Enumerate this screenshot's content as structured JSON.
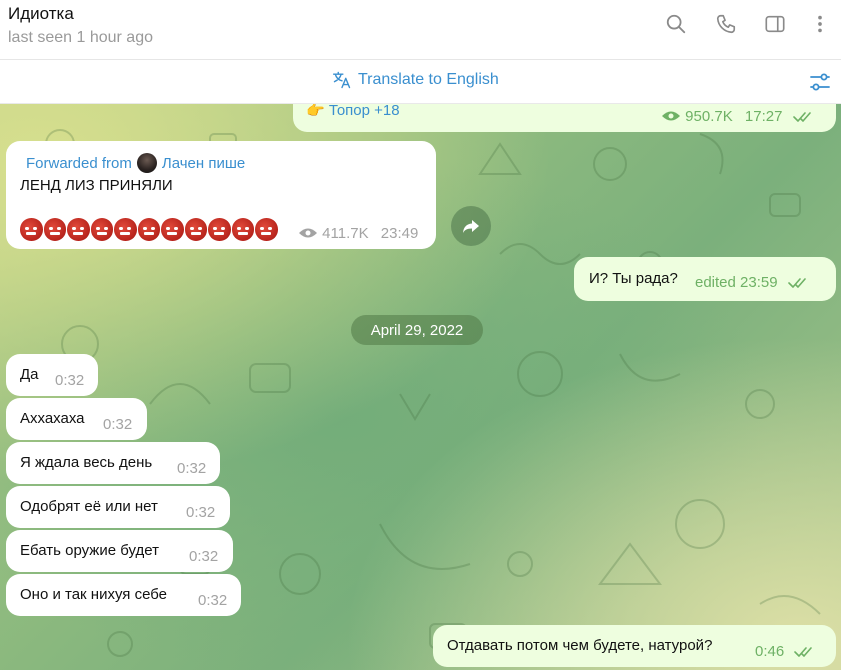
{
  "header": {
    "title": "Идиотка",
    "status": "last seen 1 hour ago",
    "icons": [
      "search-icon",
      "phone-icon",
      "sidebar-toggle-icon",
      "more-vertical-icon"
    ]
  },
  "translate": {
    "label": "Translate to English",
    "icon": "translate-icon",
    "settings_icon": "translate-settings-icon"
  },
  "messages": {
    "top_out": {
      "text": "👉 Топор +18",
      "views": "950.7K",
      "time": "17:27"
    },
    "forwarded": {
      "fwd_label": "Forwarded from",
      "fwd_source": "Лачен пише",
      "text": "ЛЕНД ЛИЗ ПРИНЯЛИ",
      "emoji_count": 11,
      "views": "411.7K",
      "time": "23:49"
    },
    "out_question": {
      "text": "И? Ты рада?",
      "meta": "edited 23:59"
    },
    "date_divider": "April 29, 2022",
    "incoming": [
      {
        "text": "Да",
        "time": "0:32"
      },
      {
        "text": "Аххахаха",
        "time": "0:32"
      },
      {
        "text": "Я ждала весь день",
        "time": "0:32"
      },
      {
        "text": "Одобрят её или нет",
        "time": "0:32"
      },
      {
        "text": "Ебать оружие будет",
        "time": "0:32"
      },
      {
        "text": "Оно и так нихуя себе",
        "time": "0:32"
      }
    ],
    "last_out": {
      "text": "Отдавать потом чем будете, натурой?",
      "time": "0:46"
    }
  },
  "colors": {
    "accent": "#3a8fcf",
    "outgoing_bubble": "#eefedf",
    "outgoing_meta": "#6eb165",
    "incoming_bubble": "#ffffff"
  }
}
